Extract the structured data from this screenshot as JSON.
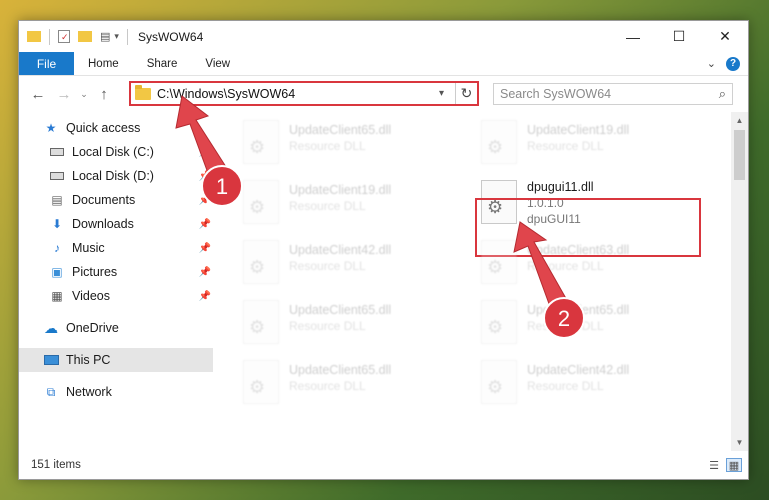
{
  "window": {
    "title": "SysWOW64",
    "controls": {
      "minimize": "—",
      "maximize": "☐",
      "close": "✕"
    }
  },
  "ribbon": {
    "file_tab": "File",
    "tabs": [
      "Home",
      "Share",
      "View"
    ],
    "expand": "⌄",
    "help": "?"
  },
  "nav": {
    "back": "←",
    "forward": "→",
    "recent": "⌄",
    "up": "↑",
    "address": "C:\\Windows\\SysWOW64",
    "refresh": "↻",
    "search_placeholder": "Search SysWOW64"
  },
  "sidebar": {
    "items": [
      {
        "label": "Quick access",
        "icon": "star-icon",
        "glyph": "★",
        "color": "#2a7bd3"
      },
      {
        "label": "Local Disk (C:)",
        "icon": "drive-icon",
        "glyph": "▭",
        "pin": true
      },
      {
        "label": "Local Disk (D:)",
        "icon": "drive-icon",
        "glyph": "▭",
        "pin": true
      },
      {
        "label": "Documents",
        "icon": "documents-icon",
        "glyph": "▤",
        "pin": true
      },
      {
        "label": "Downloads",
        "icon": "downloads-icon",
        "glyph": "⬇",
        "pin": true,
        "color": "#2a7bd3"
      },
      {
        "label": "Music",
        "icon": "music-icon",
        "glyph": "♪",
        "pin": true,
        "color": "#2a7bd3"
      },
      {
        "label": "Pictures",
        "icon": "pictures-icon",
        "glyph": "▣",
        "pin": true,
        "color": "#3a8fd8"
      },
      {
        "label": "Videos",
        "icon": "videos-icon",
        "glyph": "▦",
        "pin": true
      },
      {
        "label": "OneDrive",
        "icon": "cloud-icon",
        "glyph": "☁",
        "color": "#1979ca"
      },
      {
        "label": "This PC",
        "icon": "computer-icon",
        "glyph": "🖥",
        "selected": true
      },
      {
        "label": "Network",
        "icon": "network-icon",
        "glyph": "🖧",
        "color": "#2a7bd3"
      }
    ]
  },
  "files": [
    {
      "name": "UpdateClient65.dll",
      "type": "Resource DLL",
      "faded": true
    },
    {
      "name": "UpdateClient19.dll",
      "type": "Resource DLL",
      "faded": true
    },
    {
      "name": "UpdateClient19.dll",
      "type": "Resource DLL",
      "faded": true
    },
    {
      "name": "dpugui11.dll",
      "version": "1.0.1.0",
      "type": "dpuGUI11",
      "faded": false,
      "highlighted": true
    },
    {
      "name": "UpdateClient42.dll",
      "type": "Resource DLL",
      "faded": true
    },
    {
      "name": "UpdateClient63.dll",
      "type": "Resource DLL",
      "faded": true
    },
    {
      "name": "UpdateClient65.dll",
      "type": "Resource DLL",
      "faded": true
    },
    {
      "name": "UpdateClient65.dll",
      "type": "Resource DLL",
      "faded": true
    },
    {
      "name": "UpdateClient65.dll",
      "type": "Resource DLL",
      "faded": true
    },
    {
      "name": "UpdateClient42.dll",
      "type": "Resource DLL",
      "faded": true
    }
  ],
  "status": {
    "count": "151 items"
  },
  "annotations": {
    "badge1": "1",
    "badge2": "2",
    "color": "#d9363e"
  }
}
